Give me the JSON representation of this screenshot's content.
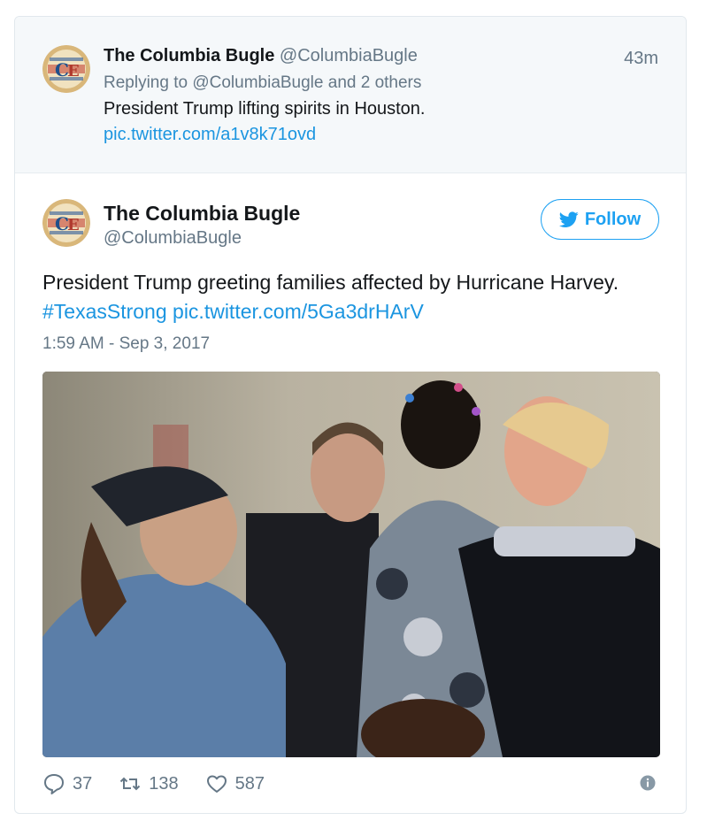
{
  "reply_tweet": {
    "name": "The Columbia Bugle",
    "handle": "@ColumbiaBugle",
    "time": "43m",
    "replying_to": "Replying to @ColumbiaBugle and 2 others",
    "text": "President Trump lifting spirits in Houston.",
    "link": "pic.twitter.com/a1v8k71ovd",
    "avatar_icon": "columbia-bugle-logo"
  },
  "main_tweet": {
    "name": "The Columbia Bugle",
    "handle": "@ColumbiaBugle",
    "follow_label": "Follow",
    "text": "President Trump greeting families affected by Hurricane Harvey.",
    "hashtag": "#TexasStrong",
    "link": "pic.twitter.com/5Ga3drHArV",
    "timestamp": "1:59 AM - Sep 3, 2017",
    "avatar_icon": "columbia-bugle-logo"
  },
  "actions": {
    "reply_count": "37",
    "retweet_count": "138",
    "like_count": "587"
  },
  "colors": {
    "accent": "#1da1f2",
    "link": "#1b95e0",
    "secondary_text": "#657786",
    "reply_background": "#f5f8fa"
  }
}
